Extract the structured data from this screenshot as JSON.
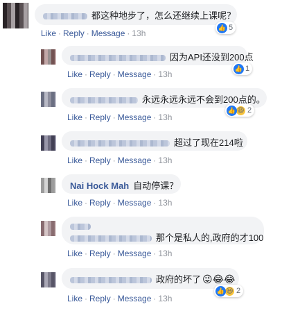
{
  "actions": {
    "like": "Like",
    "reply": "Reply",
    "message": "Message",
    "separator": "·"
  },
  "comments": [
    {
      "author": "",
      "text": "都这种地步了，怎么还继续上课呢？",
      "time": "13h",
      "reaction_count": "5"
    },
    {
      "author": "",
      "text": "因为API还没到200点",
      "time": "13h",
      "reaction_count": "1"
    },
    {
      "author": "",
      "text": "永远永远永远不会到200点的。",
      "time": "13h",
      "reaction_count": "2"
    },
    {
      "author": "",
      "text": "超过了现在214啦",
      "time": "13h",
      "reaction_count": ""
    },
    {
      "author": "Nai Hock Mah",
      "text": "自动停课？",
      "time": "13h",
      "reaction_count": ""
    },
    {
      "author": "",
      "text": "那个是私人的,政府的才100",
      "time": "13h",
      "reaction_count": ""
    },
    {
      "author": "",
      "text": "政府的坏了",
      "emojis": "😜😂😂",
      "time": "13h",
      "reaction_count": "2"
    }
  ],
  "icons": {
    "like": "thumbs-up-icon",
    "haha": "laughing-face-icon"
  },
  "colors": {
    "link": "#385898",
    "bubble": "#f2f3f5",
    "like_blue": "#2078f4"
  }
}
